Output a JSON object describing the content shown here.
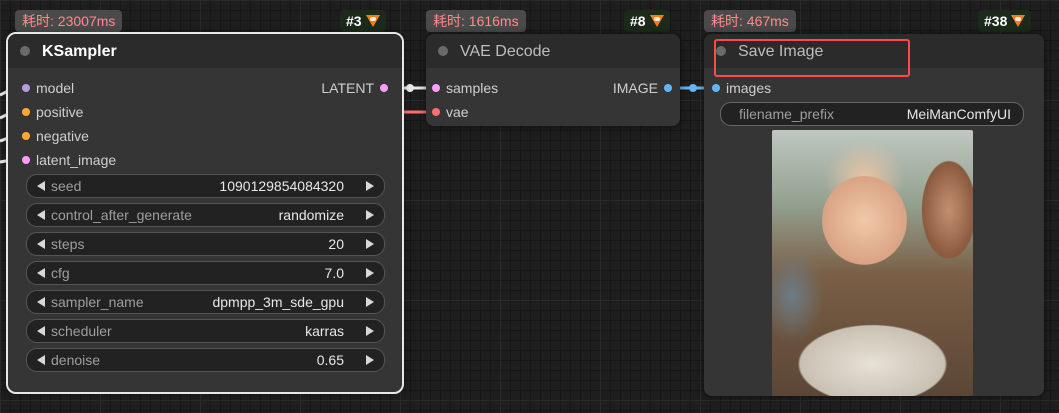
{
  "nodes": {
    "ksampler": {
      "time_badge": "耗时: 23007ms",
      "id_badge": "#3",
      "title": "KSampler",
      "inputs": [
        "model",
        "positive",
        "negative",
        "latent_image"
      ],
      "output": "LATENT",
      "widgets": [
        {
          "name": "seed",
          "value": "1090129854084320"
        },
        {
          "name": "control_after_generate",
          "value": "randomize"
        },
        {
          "name": "steps",
          "value": "20"
        },
        {
          "name": "cfg",
          "value": "7.0"
        },
        {
          "name": "sampler_name",
          "value": "dpmpp_3m_sde_gpu"
        },
        {
          "name": "scheduler",
          "value": "karras"
        },
        {
          "name": "denoise",
          "value": "0.65"
        }
      ]
    },
    "vae_decode": {
      "time_badge": "耗时: 1616ms",
      "id_badge": "#8",
      "title": "VAE Decode",
      "inputs": [
        "samples",
        "vae"
      ],
      "output": "IMAGE"
    },
    "save_image": {
      "time_badge": "耗时: 467ms",
      "id_badge": "#38",
      "title": "Save Image",
      "input": "images",
      "filename_prefix": {
        "name": "filename_prefix",
        "value": "MeiManComfyUI"
      }
    }
  },
  "slot_colors": {
    "model": "#b39ddb",
    "conditioning": "#ffa931",
    "latent": "#ff9cf9",
    "image": "#64b5f6",
    "vae": "#ff6e6e"
  },
  "icons": [
    "fox-icon",
    "arrow-left-icon",
    "arrow-right-icon",
    "status-dot-icon"
  ]
}
